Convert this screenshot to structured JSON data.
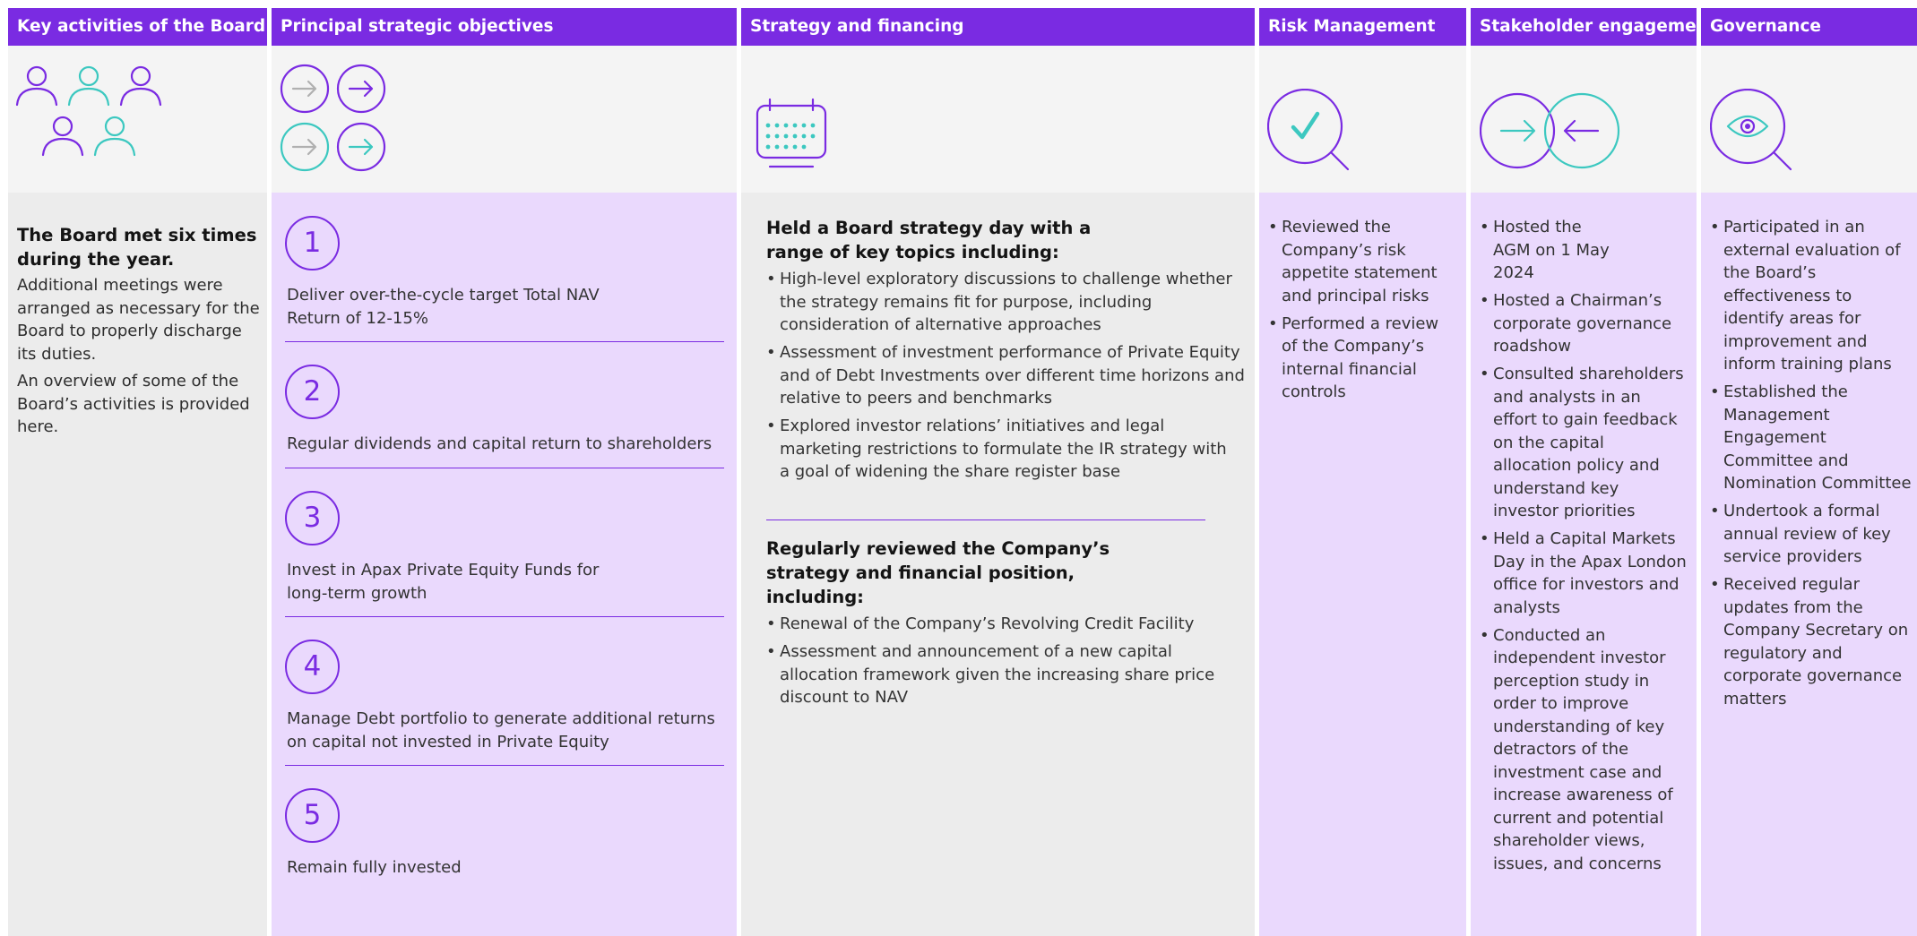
{
  "colors": {
    "header": "#7a2be2",
    "purple": "#7a2be2",
    "teal": "#3cc8c0",
    "lilac_bg": "#ead9fd",
    "grey_bg": "#ececec",
    "icon_bg": "#f4f4f4"
  },
  "columns": {
    "key_activities": {
      "header": "Key activities of the Board",
      "icon": "board-members-icon",
      "lead": "The Board met six times during the year.",
      "paragraphs": [
        "Additional meetings were arranged as necessary for the Board to properly discharge its duties.",
        "An overview of some of the Board’s activities is provided here."
      ]
    },
    "objectives": {
      "header": "Principal strategic objectives",
      "icon": "arrows-grid-icon",
      "items": [
        {
          "number": "1",
          "text": "Deliver over-the-cycle target Total NAV Return of 12-15%"
        },
        {
          "number": "2",
          "text": "Regular dividends and capital return to shareholders"
        },
        {
          "number": "3",
          "text": "Invest in Apax Private Equity Funds for long-term growth"
        },
        {
          "number": "4",
          "text": "Manage Debt portfolio to generate additional returns on capital not invested in Private Equity"
        },
        {
          "number": "5",
          "text": "Remain fully invested"
        }
      ]
    },
    "strategy": {
      "header": "Strategy and financing",
      "icon": "calendar-icon",
      "section1_title": "Held a Board strategy day with a range of key topics including:",
      "section1_bullets": [
        "High-level exploratory discussions to challenge whether the strategy remains fit for purpose, including consideration of alternative approaches",
        "Assessment of investment performance of Private Equity and of Debt Investments over different time horizons and relative to peers and benchmarks",
        "Explored investor relations’ initiatives and legal marketing restrictions to formulate the IR strategy with a goal of widening the share register base"
      ],
      "section2_title": "Regularly reviewed the Company’s strategy and financial position, including:",
      "section2_bullets": [
        "Renewal of the Company’s Revolving Credit Facility",
        "Assessment and announcement of a new capital allocation framework given the increasing share price discount to NAV"
      ]
    },
    "risk": {
      "header": "Risk Management",
      "icon": "magnifier-check-icon",
      "bullets": [
        "Reviewed the Company’s risk appetite statement and principal risks",
        "Performed a review of the Company’s internal financial controls"
      ]
    },
    "stakeholder": {
      "header": "Stakeholder engagement",
      "icon": "exchange-arrows-icon",
      "bullets": [
        "Hosted the AGM on 1 May 2024",
        "Hosted a Chairman’s corporate governance roadshow",
        "Consulted shareholders and analysts in an effort to gain feedback on the capital allocation policy and understand key investor priorities",
        "Held a Capital Markets Day in the Apax London office for investors and analysts",
        "Conducted an independent investor perception study in order to improve understanding of key detractors of the investment case and increase awareness of current and potential shareholder views, issues, and concerns"
      ]
    },
    "governance": {
      "header": "Governance",
      "icon": "magnifier-eye-icon",
      "bullets": [
        "Participated in an external evaluation of the Board’s effectiveness to identify areas for improvement and inform training plans",
        "Established the Management Engagement Committee and Nomination Committee",
        "Undertook a formal annual review of key service providers",
        "Received regular updates from the Company Secretary on regulatory and corporate governance matters"
      ]
    }
  }
}
